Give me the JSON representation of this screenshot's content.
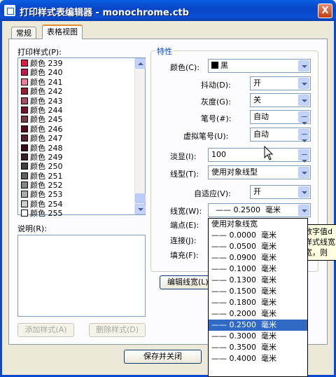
{
  "window": {
    "title": "打印样式表编辑器 - monochrome.ctb",
    "close_label": "X"
  },
  "tabs": [
    {
      "label": "常规"
    },
    {
      "label": "表格视图"
    }
  ],
  "styles_panel": {
    "label": "打印样式(P):",
    "items": [
      {
        "label": "颜色 239",
        "color": "#e8173e"
      },
      {
        "label": "颜色 240",
        "color": "#c8174e"
      },
      {
        "label": "颜色 241",
        "color": "#f07898"
      },
      {
        "label": "颜色 242",
        "color": "#9a1a38"
      },
      {
        "label": "颜色 243",
        "color": "#a84a62"
      },
      {
        "label": "颜色 244",
        "color": "#781030"
      },
      {
        "label": "颜色 245",
        "color": "#7a3848"
      },
      {
        "label": "颜色 246",
        "color": "#5a0a20"
      },
      {
        "label": "颜色 247",
        "color": "#5a2030"
      },
      {
        "label": "颜色 248",
        "color": "#3a0818"
      },
      {
        "label": "颜色 249",
        "color": "#382028"
      },
      {
        "label": "颜色 250",
        "color": "#404040"
      },
      {
        "label": "颜色 251",
        "color": "#606060"
      },
      {
        "label": "颜色 252",
        "color": "#858585"
      },
      {
        "label": "颜色 253",
        "color": "#ababab"
      },
      {
        "label": "颜色 254",
        "color": "#d0d0d0"
      },
      {
        "label": "颜色 255",
        "color": "#ffffff"
      }
    ]
  },
  "description": {
    "label": "说明(R):"
  },
  "add_style_button": "添加样式(A)",
  "delete_style_button": "删除样式(D)",
  "save_close_button": "保存并关闭",
  "properties": {
    "group_title": "特性",
    "color": {
      "label": "颜色(C):",
      "value": "黑",
      "swatch": "#000000"
    },
    "dither": {
      "label": "抖动(D):",
      "value": "开"
    },
    "grayscale": {
      "label": "灰度(G):",
      "value": "关"
    },
    "pen_number": {
      "label": "笔号(#):",
      "value": "自动"
    },
    "virtual_pen": {
      "label": "虚拟笔号(U):",
      "value": "自动"
    },
    "screening": {
      "label": "淡显(I):",
      "value": "100"
    },
    "linetype": {
      "label": "线型(T):",
      "value": "使用对象线型"
    },
    "adaptive": {
      "label": "自适应(V):",
      "value": "开"
    },
    "lineweight": {
      "label": "线宽(W):",
      "value": "—— 0.2500  毫米"
    },
    "line_end": {
      "label": "端点(E):"
    },
    "line_join": {
      "label": "连接(J):"
    },
    "fill": {
      "label": "填充(F):"
    },
    "edit_lineweights_button": "编辑线宽(L)"
  },
  "lineweight_dropdown": {
    "items": [
      "使用对象线宽",
      "—— 0.0000  毫米",
      "—— 0.0500  毫米",
      "—— 0.0900  毫米",
      "—— 0.1000  毫米",
      "—— 0.1300  毫米",
      "—— 0.1500  毫米",
      "—— 0.1800  毫米",
      "—— 0.2000  毫米",
      "—— 0.2500  毫米",
      "—— 0.3000  毫米",
      "—— 0.3500  毫米",
      "—— 0.4000  毫米"
    ],
    "selected_index": 9
  },
  "tooltip_fragment": {
    "line1": "数字值d",
    "line2": "样式线宽",
    "line3": "宽，则"
  }
}
